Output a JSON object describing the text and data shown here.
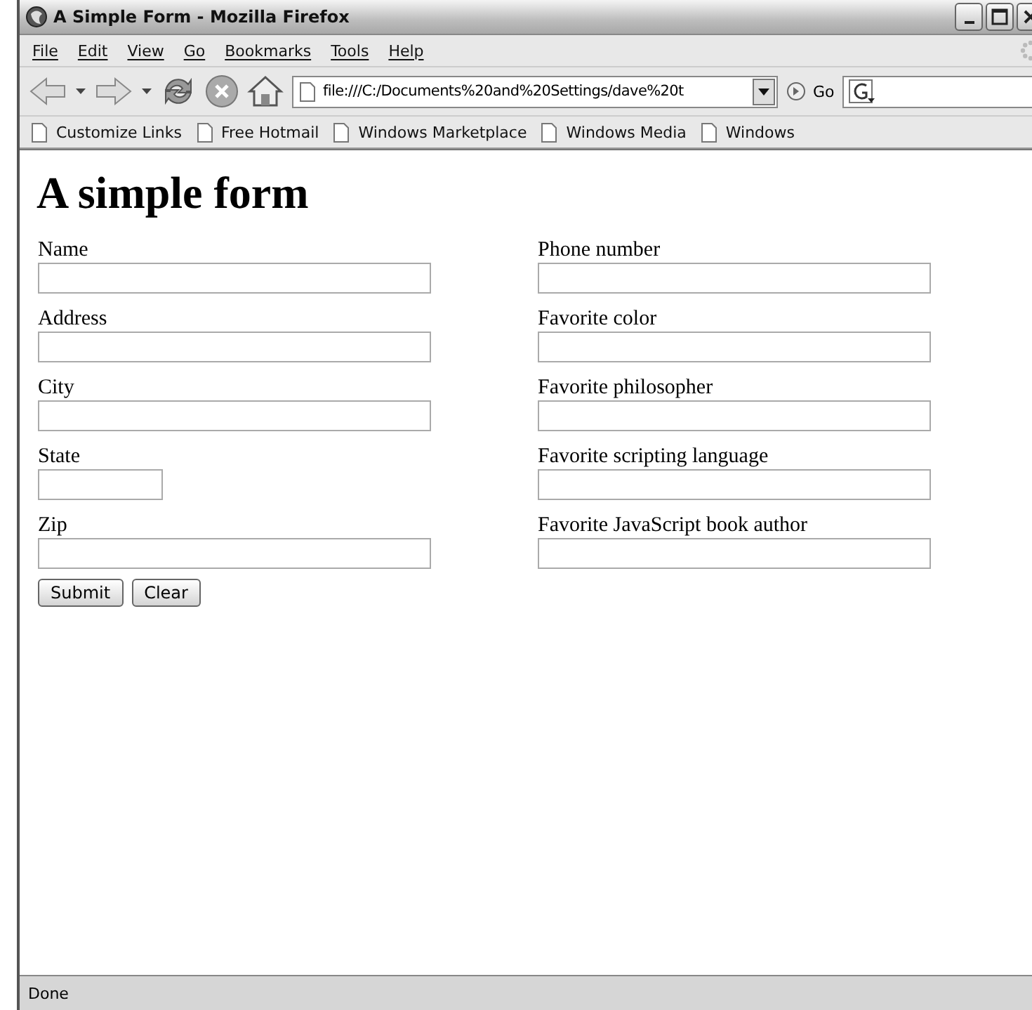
{
  "window": {
    "title": "A Simple Form - Mozilla Firefox"
  },
  "menu": [
    "File",
    "Edit",
    "View",
    "Go",
    "Bookmarks",
    "Tools",
    "Help"
  ],
  "toolbar": {
    "url": "file:///C:/Documents%20and%20Settings/dave%20t",
    "go_label": "Go"
  },
  "bookmarks": [
    "Customize Links",
    "Free Hotmail",
    "Windows Marketplace",
    "Windows Media",
    "Windows"
  ],
  "page": {
    "heading": "A simple form",
    "left_fields": [
      {
        "label": "Name",
        "kind": "wide"
      },
      {
        "label": "Address",
        "kind": "wide"
      },
      {
        "label": "City",
        "kind": "wide"
      },
      {
        "label": "State",
        "kind": "short"
      },
      {
        "label": "Zip",
        "kind": "wide"
      }
    ],
    "right_fields": [
      {
        "label": "Phone number",
        "kind": "wide"
      },
      {
        "label": "Favorite color",
        "kind": "wide"
      },
      {
        "label": "Favorite philosopher",
        "kind": "wide"
      },
      {
        "label": "Favorite scripting language",
        "kind": "wide"
      },
      {
        "label": "Favorite JavaScript book author",
        "kind": "wide"
      }
    ],
    "buttons": [
      "Submit",
      "Clear"
    ]
  },
  "status_bar": {
    "text": "Done"
  }
}
